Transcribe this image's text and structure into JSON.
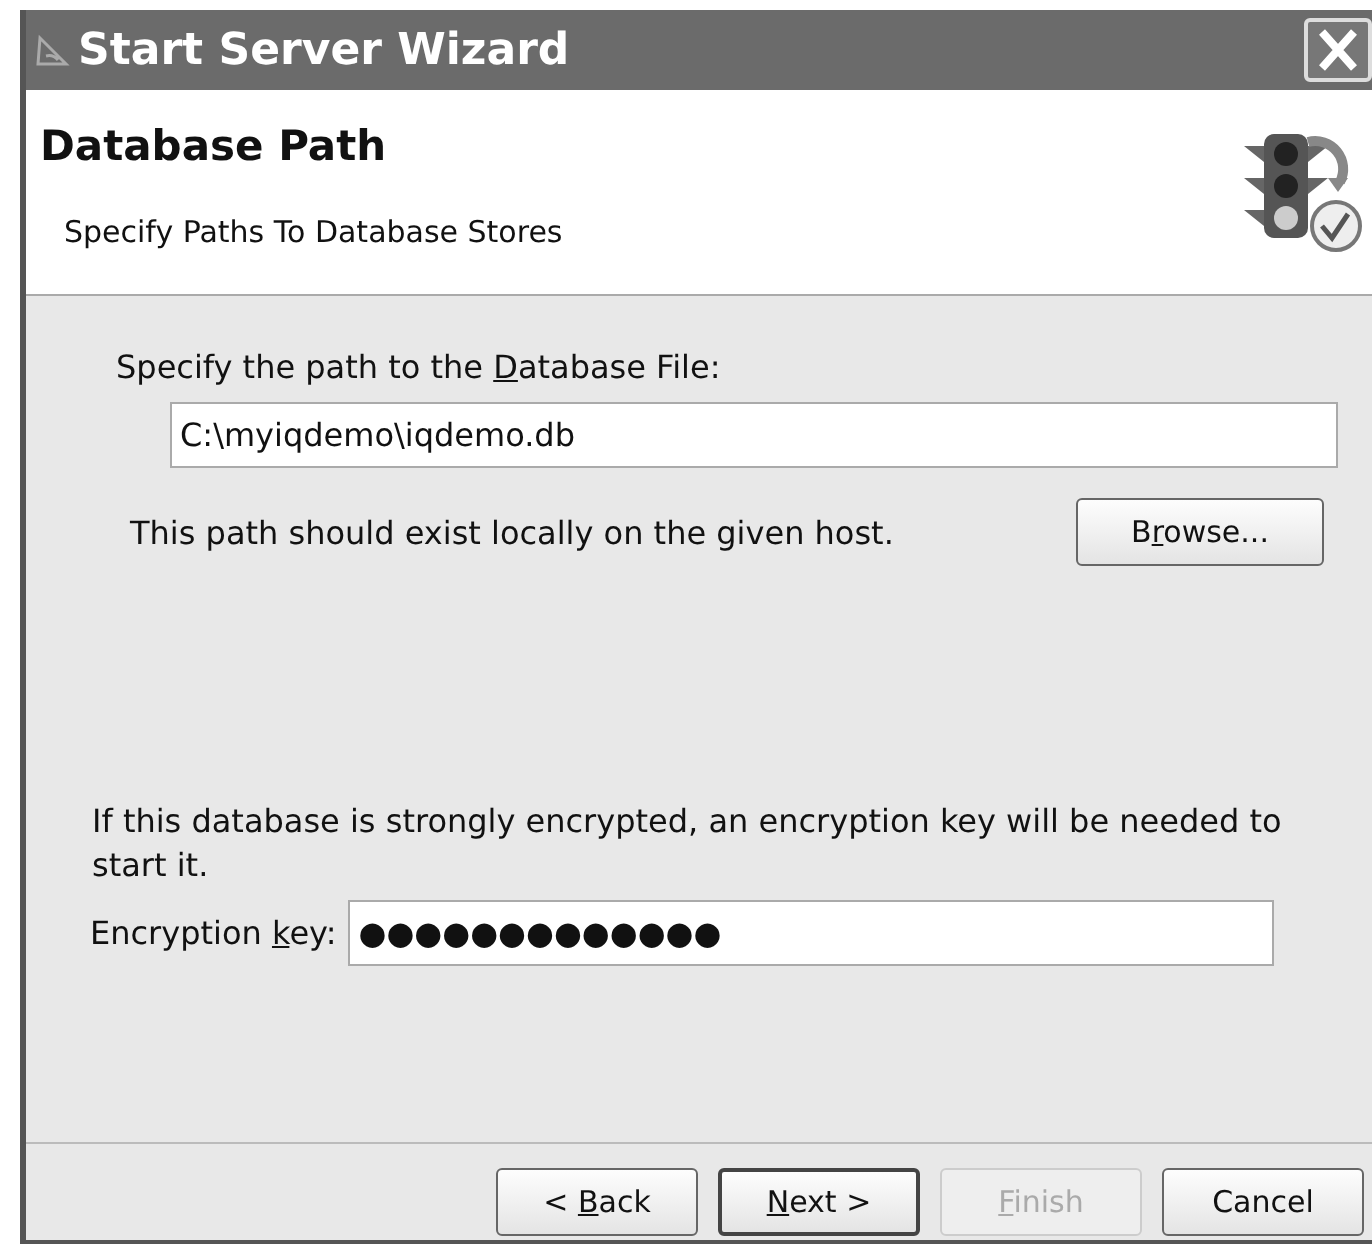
{
  "window": {
    "title": "Start Server Wizard"
  },
  "header": {
    "title": "Database Path",
    "subtitle": "Specify Paths To Database Stores"
  },
  "path_label": {
    "before": "Specify the path to the ",
    "underlined": "D",
    "after": "atabase File:"
  },
  "path_field": {
    "value": "C:\\myiqdemo\\iqdemo.db"
  },
  "path_note": "This path should exist locally on the given host.",
  "browse_button": {
    "before": "B",
    "underlined": "r",
    "after": "owse..."
  },
  "encryption_note": "If this database is strongly encrypted, an encryption key will be needed to start it.",
  "key_label": {
    "before": "Encryption ",
    "underlined": "k",
    "after": "ey:"
  },
  "key_field": {
    "value": "●●●●●●●●●●●●●"
  },
  "buttons": [
    {
      "before": "< ",
      "underlined": "B",
      "after": "ack",
      "default": false,
      "disabled": false
    },
    {
      "underlined": "N",
      "after": "ext >",
      "default": true,
      "disabled": false
    },
    {
      "underlined": "F",
      "after": "inish",
      "default": false,
      "disabled": true
    },
    {
      "before": "Cancel",
      "default": false,
      "disabled": false
    }
  ]
}
